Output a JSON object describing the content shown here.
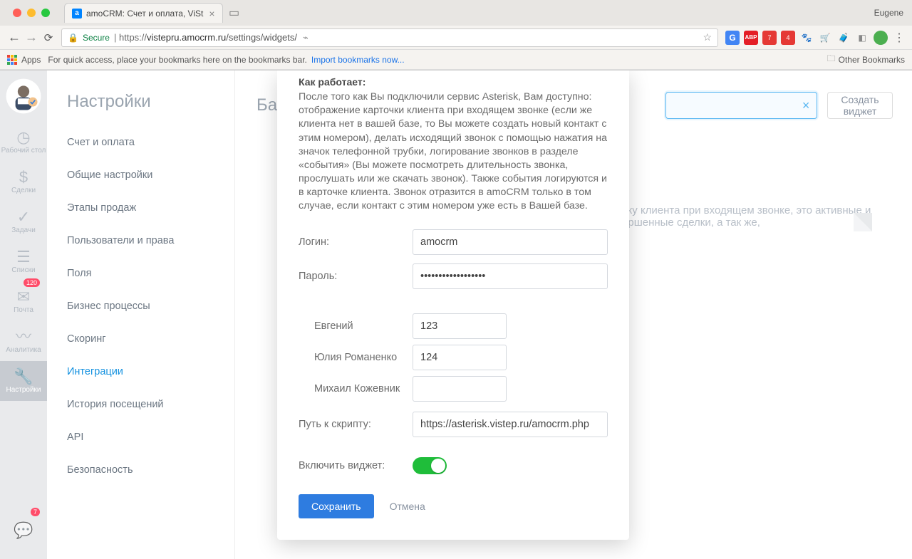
{
  "browser": {
    "profile": "Eugene",
    "tab_title": "amoCRM: Счет и оплата, ViSt",
    "secure_label": "Secure",
    "url_scheme": "https://",
    "url_host": "vistepru.amocrm.ru",
    "url_path": "/settings/widgets/",
    "apps_label": "Apps",
    "bm_tip": "For quick access, place your bookmarks here on the bookmarks bar.",
    "bm_import": "Import bookmarks now...",
    "bm_other": "Other Bookmarks"
  },
  "rail": {
    "items": [
      {
        "label": "Рабочий стол"
      },
      {
        "label": "Сделки"
      },
      {
        "label": "Задачи"
      },
      {
        "label": "Списки"
      },
      {
        "label": "Почта",
        "badge": "120"
      },
      {
        "label": "Аналитика"
      },
      {
        "label": "Настройки",
        "active": true
      }
    ],
    "bottom_badge": "7"
  },
  "sidebar": {
    "title": "Настройки",
    "items": [
      {
        "label": "Счет и оплата"
      },
      {
        "label": "Общие настройки"
      },
      {
        "label": "Этапы продаж"
      },
      {
        "label": "Пользователи и права"
      },
      {
        "label": "Поля"
      },
      {
        "label": "Бизнес процессы"
      },
      {
        "label": "Скоринг"
      },
      {
        "label": "Интеграции",
        "active": true
      },
      {
        "label": "История посещений"
      },
      {
        "label": "API"
      },
      {
        "label": "Безопасность"
      }
    ]
  },
  "main": {
    "title": "Баз",
    "create_button": "Создать виджет",
    "hint": "рточку клиента при входящем звонке, это активные и завершенные сделки, а так же,"
  },
  "modal": {
    "section_title": "Как работает:",
    "description": "После того как Вы подключили сервис Asterisk, Вам доступно: отображение карточки клиента при входящем звонке (если же клиента нет в вашей базе, то Вы можете создать новый контакт с этим номером), делать исходящий звонок с помощью нажатия на значок телефонной трубки, логирование звонков в разделе «события» (Вы можете посмотреть длительность звонка, прослушать или же скачать звонок). Также события логируются и в карточке клиента. Звонок отразится в amoCRM только в том случае, если контакт с этим номером уже есть в Вашей базе.",
    "login_label": "Логин:",
    "login_value": "amocrm",
    "password_label": "Пароль:",
    "password_value": "••••••••••••••••••",
    "users": [
      {
        "name": "Евгений",
        "ext": "123"
      },
      {
        "name": "Юлия Романенко",
        "ext": "124"
      },
      {
        "name": "Михаил Кожевник",
        "ext": ""
      }
    ],
    "script_label": "Путь к скрипту:",
    "script_value": "https://asterisk.vistep.ru/amocrm.php",
    "enable_label": "Включить виджет:",
    "save_label": "Сохранить",
    "cancel_label": "Отмена"
  }
}
